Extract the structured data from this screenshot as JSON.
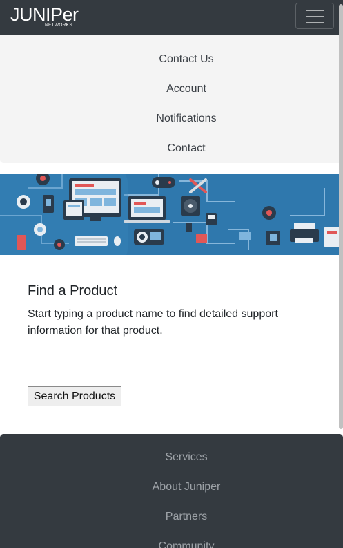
{
  "header": {
    "logo_text": "JUNIPer",
    "logo_subtext": "NETWORKS",
    "menu_icon": "hamburger-icon"
  },
  "dropdown": {
    "items": [
      {
        "label": "Contact Us"
      },
      {
        "label": "Account"
      },
      {
        "label": "Notifications"
      },
      {
        "label": "Contact"
      }
    ]
  },
  "banner": {
    "icons": [
      "monitor-icon",
      "laptop-icon",
      "gamepad-icon",
      "tools-icon",
      "fan-icon",
      "printer-icon",
      "camera-icon",
      "keyboard-icon",
      "usb-icon",
      "chip-icon"
    ]
  },
  "main": {
    "title": "Find a Product",
    "description": "Start typing a product name to find detailed support information for that product.",
    "search_value": "",
    "search_button": "Search Products"
  },
  "footer": {
    "items": [
      {
        "label": "Services"
      },
      {
        "label": "About Juniper"
      },
      {
        "label": "Partners"
      },
      {
        "label": "Community"
      }
    ]
  },
  "colors": {
    "navbar": "#343a40",
    "dropdown_bg": "#f4f4f4",
    "banner_blue": "#2f78ad",
    "footer_text": "#9ea3a8"
  }
}
